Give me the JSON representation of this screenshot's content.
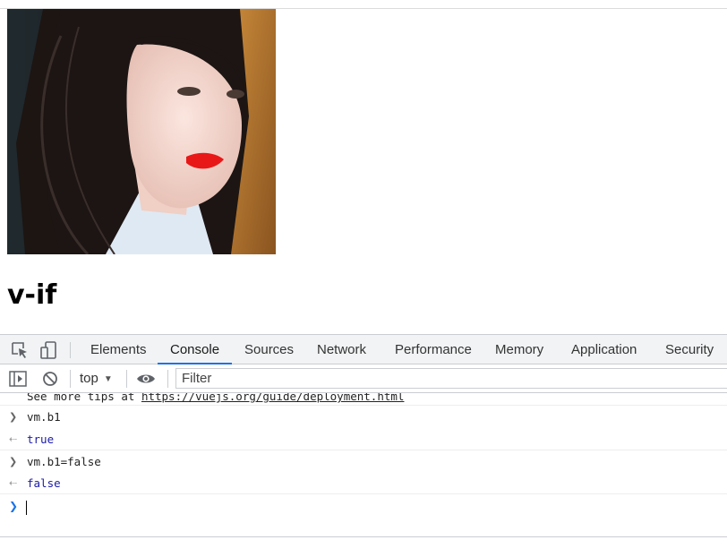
{
  "page": {
    "heading": "v-if"
  },
  "devtools": {
    "tabs": [
      {
        "label": "Elements"
      },
      {
        "label": "Console"
      },
      {
        "label": "Sources"
      },
      {
        "label": "Network"
      },
      {
        "label": "Performance"
      },
      {
        "label": "Memory"
      },
      {
        "label": "Application"
      },
      {
        "label": "Security"
      }
    ],
    "active_tab": "Console",
    "toolbar": {
      "context": "top",
      "filter_placeholder": "Filter"
    },
    "console": {
      "tip_prefix": "See more tips at ",
      "tip_link": "https://vuejs.org/guide/deployment.html",
      "entries": [
        {
          "kind": "input",
          "text": "vm.b1"
        },
        {
          "kind": "result",
          "text": "true"
        },
        {
          "kind": "input",
          "text": "vm.b1=false"
        },
        {
          "kind": "result",
          "text": "false"
        }
      ]
    }
  },
  "icons": {
    "inspect": "inspect-element-icon",
    "device": "device-toolbar-icon",
    "sidebar": "console-sidebar-icon",
    "clear": "clear-console-icon",
    "eye": "live-expression-eye-icon",
    "input_chevron": "chevron-right-icon",
    "result_arrow": "result-arrow-icon"
  },
  "colors": {
    "active_tab_underline": "#1a73e8",
    "result_text": "#1a1aa6",
    "prompt": "#1a73e8"
  }
}
